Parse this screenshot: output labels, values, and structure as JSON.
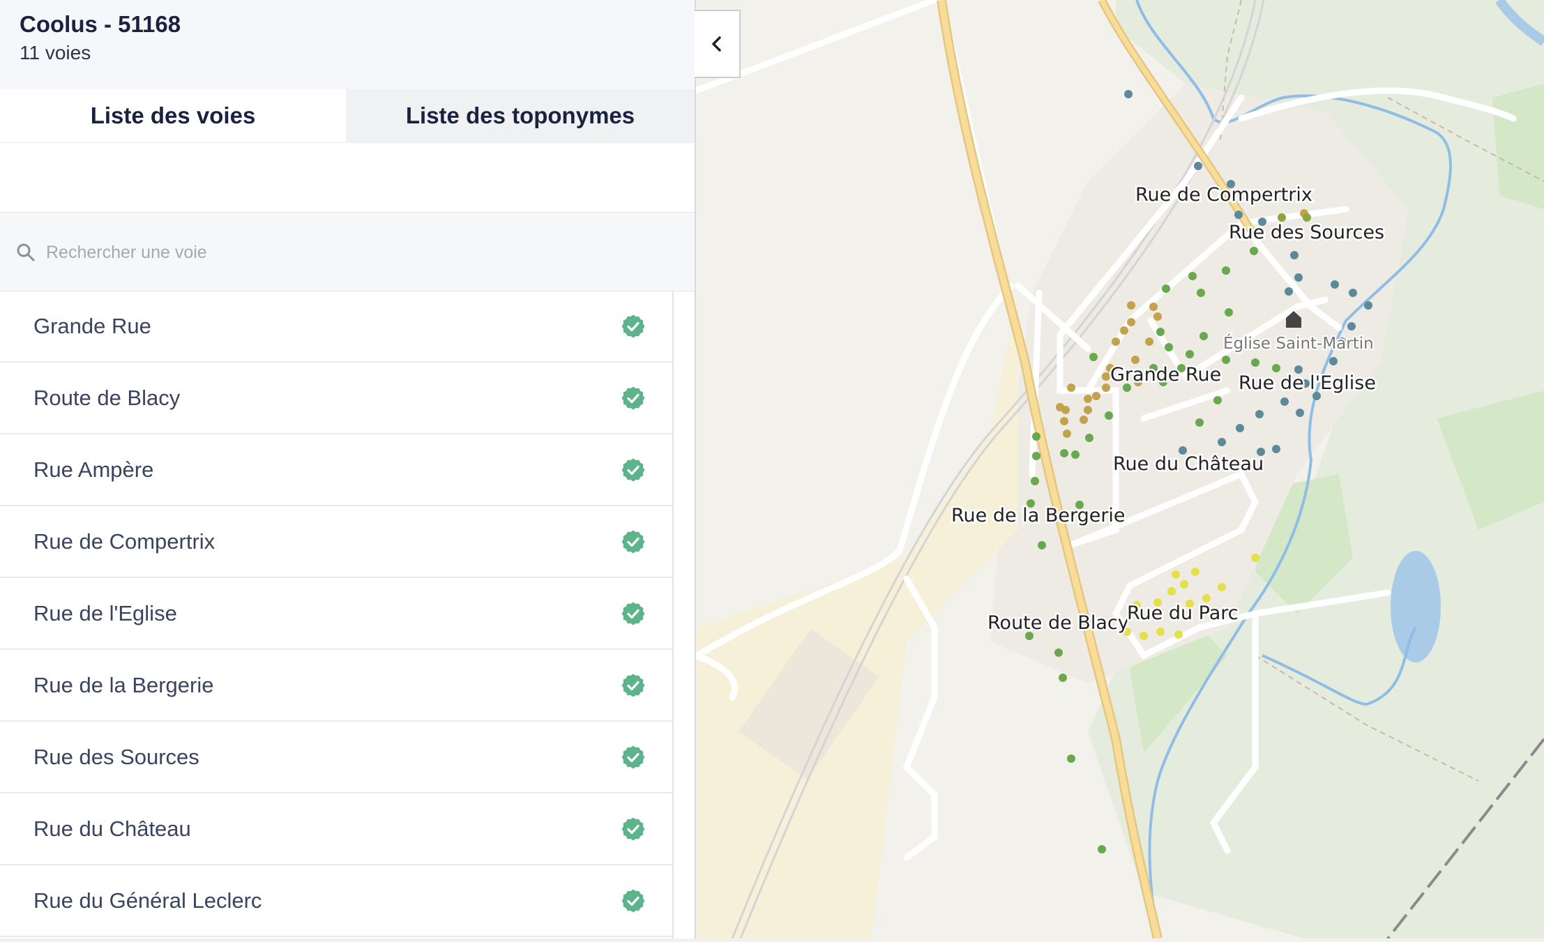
{
  "header": {
    "title": "Coolus - 51168",
    "subtitle": "11 voies"
  },
  "tabs": {
    "voies": "Liste des voies",
    "toponymes": "Liste des toponymes"
  },
  "search": {
    "placeholder": "Rechercher une voie",
    "icon": "search-icon"
  },
  "voies": [
    {
      "name": "Grande Rue",
      "status": "certified"
    },
    {
      "name": "Route de Blacy",
      "status": "certified"
    },
    {
      "name": "Rue Ampère",
      "status": "certified"
    },
    {
      "name": "Rue de Compertrix",
      "status": "certified"
    },
    {
      "name": "Rue de l'Eglise",
      "status": "certified"
    },
    {
      "name": "Rue de la Bergerie",
      "status": "certified"
    },
    {
      "name": "Rue des Sources",
      "status": "certified"
    },
    {
      "name": "Rue du Château",
      "status": "certified"
    },
    {
      "name": "Rue du Général Leclerc",
      "status": "certified"
    }
  ],
  "colors": {
    "check": "#5db48a",
    "map_background": "#f3f1ec",
    "main_road": "#f6d894",
    "water": "#a9cbe8"
  },
  "map": {
    "labels": {
      "compertrix": "Rue de Compertrix",
      "sources": "Rue des Sources",
      "eglise_poi": "Église Saint-Martin",
      "grande_rue": "Grande Rue",
      "eglise_rue": "Rue de l'Eglise",
      "chateau": "Rue du Château",
      "bergerie": "Rue de la Bergerie",
      "blacy": "Route de Blacy",
      "parc": "Rue du Parc"
    }
  }
}
